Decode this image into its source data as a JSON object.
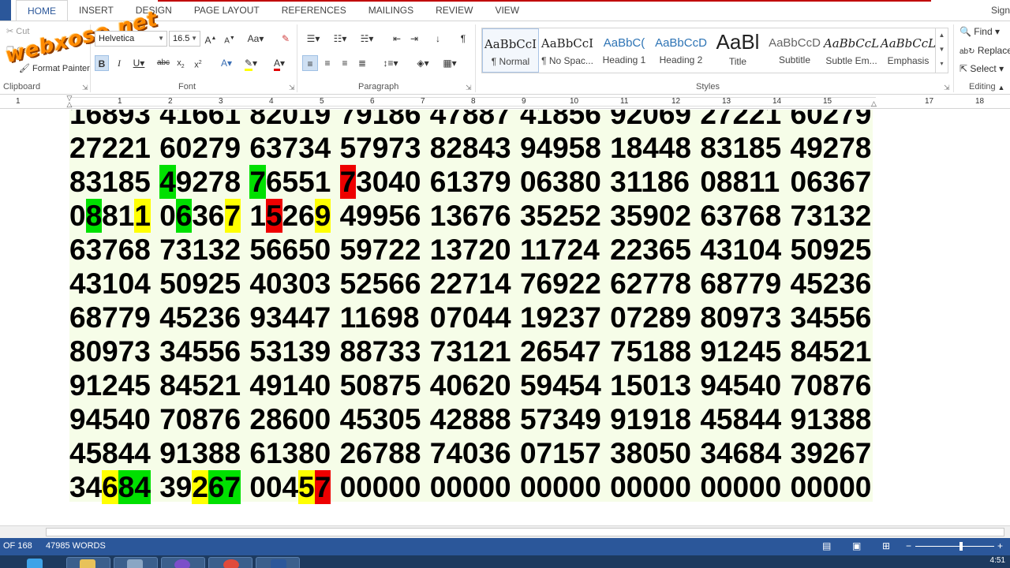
{
  "tabs": [
    "HOME",
    "INSERT",
    "DESIGN",
    "PAGE LAYOUT",
    "REFERENCES",
    "MAILINGS",
    "REVIEW",
    "VIEW"
  ],
  "signin": "Sign",
  "watermark": "webxoso.net",
  "clipboard": {
    "cut": "Cut",
    "copy": "Copy",
    "painter": "Format Painter",
    "label": "Clipboard"
  },
  "font": {
    "name": "Helvetica",
    "size": "16.5",
    "label": "Font"
  },
  "paragraph": {
    "label": "Paragraph"
  },
  "styles": {
    "label": "Styles",
    "items": [
      {
        "sample": "AaBbCcI",
        "name": "¶ Normal"
      },
      {
        "sample": "AaBbCcI",
        "name": "¶ No Spac..."
      },
      {
        "sample": "AaBbC(",
        "name": "Heading 1"
      },
      {
        "sample": "AaBbCcD",
        "name": "Heading 2"
      },
      {
        "sample": "AaBl",
        "name": "Title"
      },
      {
        "sample": "AaBbCcD",
        "name": "Subtitle"
      },
      {
        "sample": "AaBbCcL",
        "name": "Subtle Em..."
      },
      {
        "sample": "AaBbCcL",
        "name": "Emphasis"
      }
    ]
  },
  "editing": {
    "find": "Find",
    "replace": "Replace",
    "select": "Select",
    "label": "Editing"
  },
  "ruler": [
    "1",
    "1",
    "2",
    "3",
    "4",
    "5",
    "6",
    "7",
    "8",
    "9",
    "10",
    "11",
    "12",
    "13",
    "14",
    "15",
    "17",
    "18"
  ],
  "document": {
    "rows": [
      {
        "text": "16893 41661 82019 79186 47887 41856 92069 27221 60279",
        "hl": []
      },
      {
        "text": "27221 60279 63734 57973 82843 94958 18448 83185 49278",
        "hl": []
      },
      {
        "text": "83185 49278 76551 73040 61379 06380 31186 08811 06367",
        "hl": [
          [
            1,
            0,
            "g"
          ],
          [
            2,
            0,
            "g"
          ],
          [
            3,
            0,
            "r"
          ]
        ]
      },
      {
        "text": "08811 06367 15269 49956 13676 35252 35902 63768 73132",
        "hl": [
          [
            0,
            1,
            "g"
          ],
          [
            0,
            4,
            "y"
          ],
          [
            1,
            1,
            "g"
          ],
          [
            1,
            4,
            "y"
          ],
          [
            2,
            1,
            "r"
          ],
          [
            2,
            4,
            "y"
          ]
        ]
      },
      {
        "text": "63768 73132 56650 59722 13720 11724 22365 43104 50925",
        "hl": []
      },
      {
        "text": "43104 50925 40303 52566 22714 76922 62778 68779 45236",
        "hl": []
      },
      {
        "text": "68779 45236 93447 11698 07044 19237 07289 80973 34556",
        "hl": []
      },
      {
        "text": "80973 34556 53139 88733 73121 26547 75188 91245 84521",
        "hl": []
      },
      {
        "text": "91245 84521 49140 50875 40620 59454 15013 94540 70876",
        "hl": []
      },
      {
        "text": "94540 70876 28600 45305 42888 57349 91918 45844 91388",
        "hl": []
      },
      {
        "text": "45844 91388 61380 26788 74036 07157 38050 34684 39267",
        "hl": []
      },
      {
        "text": "34684 39267 00457 00000 00000 00000 00000 00000 00000",
        "hl": [
          [
            0,
            2,
            "y"
          ],
          [
            0,
            3,
            "g"
          ],
          [
            0,
            4,
            "g"
          ],
          [
            1,
            2,
            "y"
          ],
          [
            1,
            3,
            "g"
          ],
          [
            1,
            4,
            "g"
          ],
          [
            2,
            3,
            "y"
          ],
          [
            2,
            4,
            "r"
          ],
          [
            2,
            5,
            "r"
          ]
        ]
      }
    ]
  },
  "status": {
    "page": "OF 168",
    "words": "47985 WORDS"
  },
  "clock": "4:51"
}
